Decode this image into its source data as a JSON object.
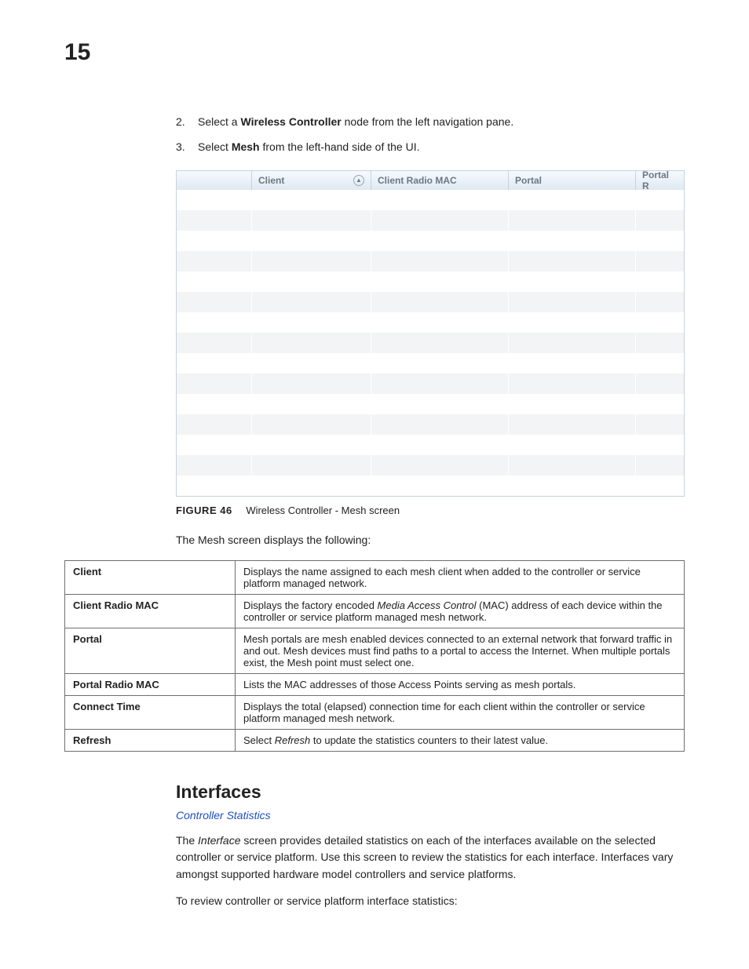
{
  "page_number": "15",
  "steps": [
    {
      "num": "2.",
      "pre": "Select a ",
      "bold": "Wireless Controller",
      "post": " node from the left navigation pane."
    },
    {
      "num": "3.",
      "pre": "Select ",
      "bold": "Mesh",
      "post": " from the left-hand side of the UI."
    }
  ],
  "mesh_shot": {
    "headers": [
      "",
      "Client",
      "Client Radio MAC",
      "Portal",
      "Portal R"
    ],
    "sort_col_index": 1,
    "blank_row_count": 15
  },
  "figure": {
    "label": "FIGURE 46",
    "caption": "Wireless Controller - Mesh screen"
  },
  "mesh_intro": "The Mesh screen displays the following:",
  "defs": [
    {
      "term": "Client",
      "desc_pre": "Displays the name assigned to each mesh client when added to the controller or service platform managed network.",
      "italic": "",
      "desc_post": ""
    },
    {
      "term": "Client Radio MAC",
      "desc_pre": "Displays the factory encoded ",
      "italic": "Media Access Control",
      "desc_post": " (MAC) address of each device within the controller or service platform managed mesh network."
    },
    {
      "term": "Portal",
      "desc_pre": "Mesh portals are mesh enabled devices connected to an external network that forward traffic in and out. Mesh devices must find paths to a portal to access the Internet. When multiple portals exist, the Mesh point must select one.",
      "italic": "",
      "desc_post": ""
    },
    {
      "term": "Portal Radio MAC",
      "desc_pre": "Lists the MAC addresses of those Access Points serving as mesh portals.",
      "italic": "",
      "desc_post": ""
    },
    {
      "term": "Connect Time",
      "desc_pre": "Displays the total (elapsed) connection time for each client within the controller or service platform managed mesh network.",
      "italic": "",
      "desc_post": ""
    },
    {
      "term": "Refresh",
      "desc_pre": "Select ",
      "italic": "Refresh",
      "desc_post": " to update the statistics counters to their latest value."
    }
  ],
  "section_heading": "Interfaces",
  "link_text": "Controller Statistics",
  "interfaces_para_pre": "The ",
  "interfaces_para_italic": "Interface",
  "interfaces_para_post": " screen provides detailed statistics on each of the interfaces available on the selected controller or service platform. Use this screen to review the statistics for each interface. Interfaces vary amongst supported hardware model controllers and service platforms.",
  "interfaces_para2": "To review controller or service platform interface statistics:"
}
